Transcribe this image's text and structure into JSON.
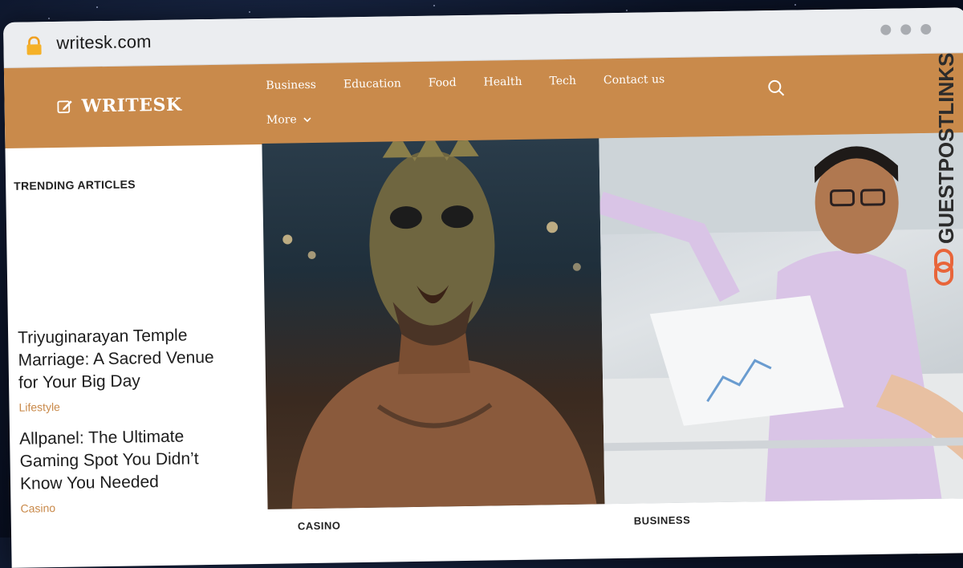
{
  "browser": {
    "url": "writesk.com"
  },
  "site": {
    "logo_text": "WRITESK",
    "nav": [
      "Business",
      "Education",
      "Food",
      "Health",
      "Tech",
      "Contact us"
    ],
    "more_label": "More"
  },
  "sidebar": {
    "heading": "TRENDING ARTICLES",
    "articles": [
      {
        "title": "Triyuginarayan Temple Marriage: A Sacred Venue for Your Big Day",
        "category": "Lifestyle"
      },
      {
        "title": "Allpanel: The Ultimate Gaming Spot You Didn’t Know You Needed",
        "category": "Casino"
      }
    ]
  },
  "featured": {
    "left_category": "CASINO",
    "right_category": "BUSINESS"
  },
  "watermark": "GUESTPOSTLINKS",
  "colors": {
    "accent": "#c98a4b",
    "watermark": "#2b2b2b",
    "watermark_link": "#e8653a"
  }
}
